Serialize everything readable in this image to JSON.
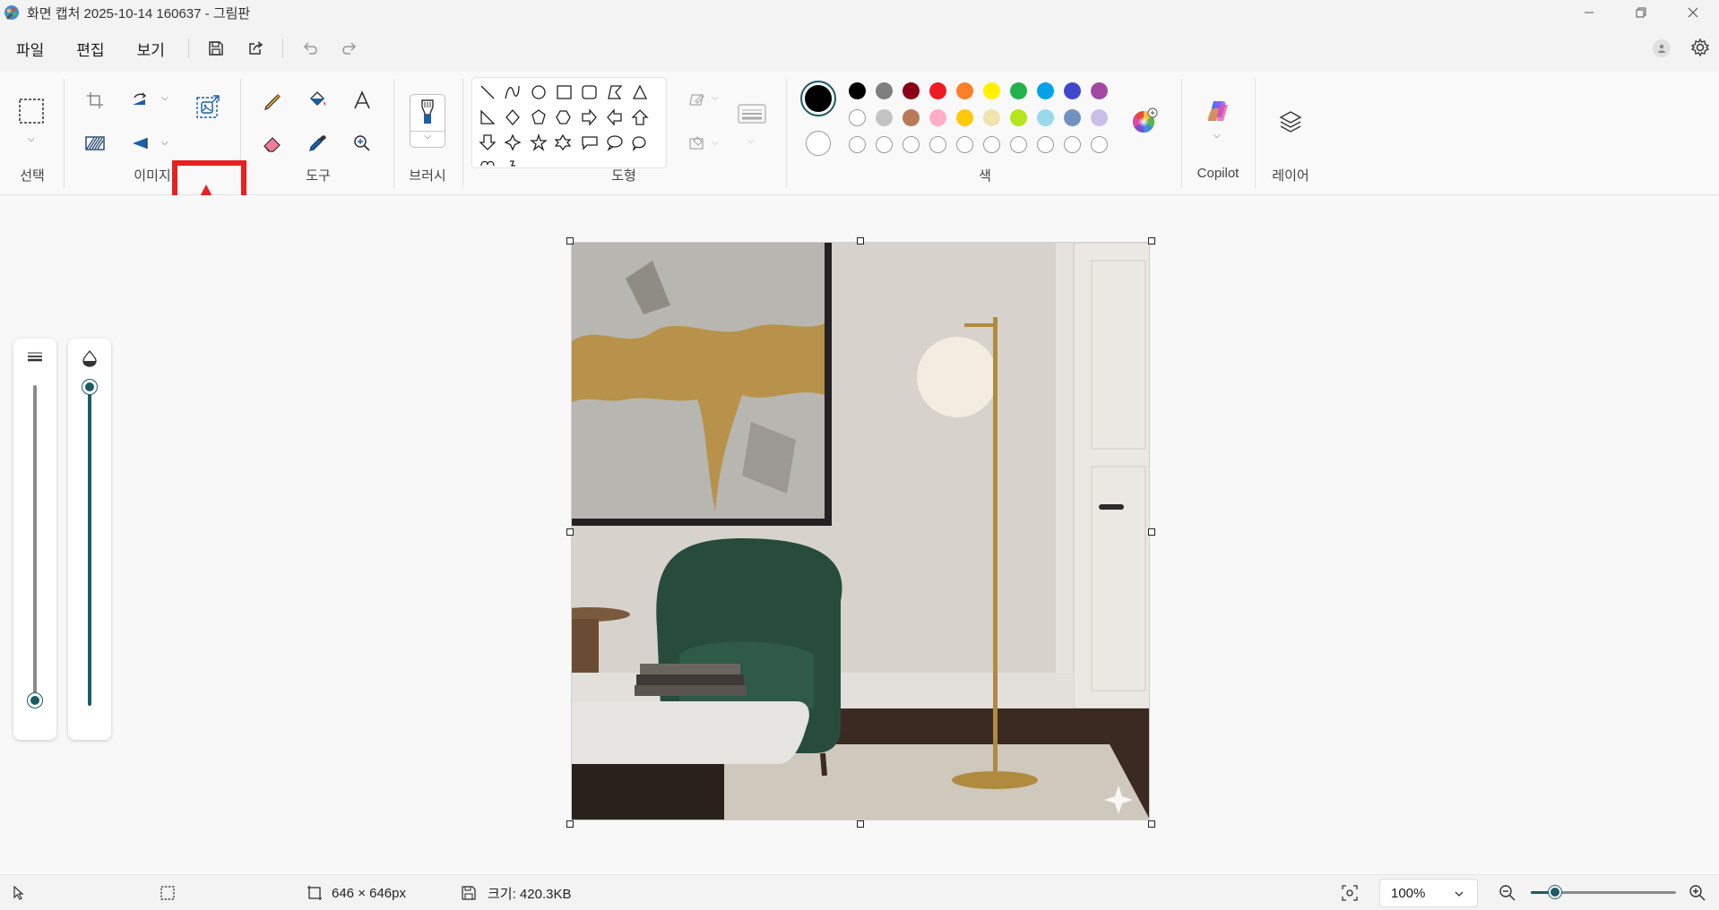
{
  "window": {
    "title": "화면 캡처 2025-10-14 160637 - 그림판",
    "controls": [
      "minimize",
      "restore",
      "close"
    ]
  },
  "menu": {
    "file": "파일",
    "edit": "편집",
    "view": "보기"
  },
  "ribbon": {
    "groups": {
      "select": "선택",
      "image": "이미지",
      "tools": "도구",
      "brush": "브러시",
      "shapes": "도형",
      "colors": "색",
      "copilot": "Copilot",
      "layers": "레이어"
    },
    "palette_row1": [
      "#000000",
      "#7f7f7f",
      "#880015",
      "#ed1c24",
      "#ff7f27",
      "#fff200",
      "#22b14c",
      "#00a2e8",
      "#3f48cc",
      "#a349a4"
    ],
    "palette_row2": [
      "#ffffff",
      "#c3c3c3",
      "#b97a57",
      "#ffaec9",
      "#ffc90e",
      "#efe4b0",
      "#b5e61d",
      "#99d9ea",
      "#7092be",
      "#c8bfe7"
    ],
    "palette_row3_empty_count": 10,
    "primary_color": "#000000",
    "secondary_color": "#ffffff",
    "highlighted_tool": "image-generator-icon"
  },
  "sliders": {
    "size_level": 0.0,
    "opacity_level": 1.0
  },
  "status": {
    "image_dimensions": "646 × 646px",
    "file_size": "크기: 420.3KB",
    "zoom": "100%"
  },
  "colors": {
    "accent": "#1d5c66",
    "annotation_red": "#e52121"
  }
}
